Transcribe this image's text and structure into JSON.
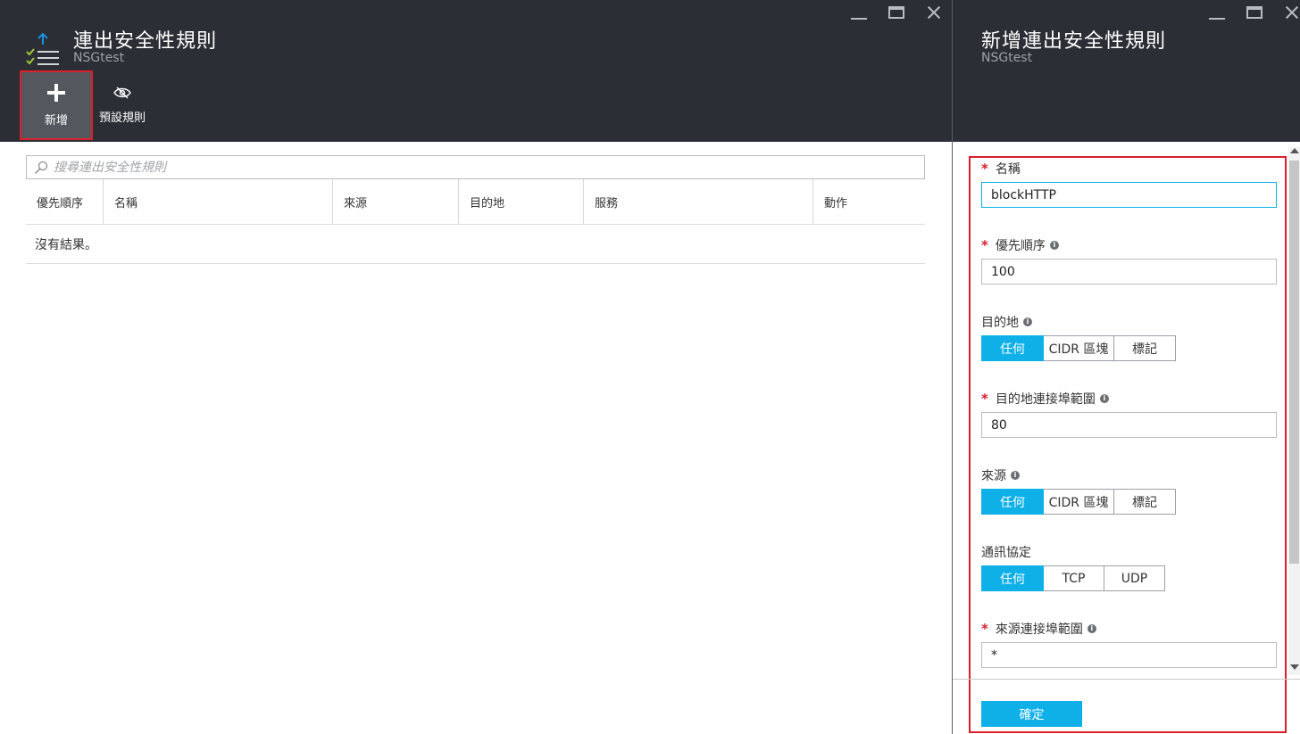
{
  "left_blade": {
    "title": "連出安全性規則",
    "subtitle": "NSGtest",
    "commands": {
      "add_label": "新增",
      "defaults_label": "預設規則"
    },
    "search": {
      "placeholder": "搜尋連出安全性規則"
    },
    "grid": {
      "columns": [
        "優先順序",
        "名稱",
        "來源",
        "目的地",
        "服務",
        "動作"
      ],
      "empty_message": "沒有結果。"
    }
  },
  "right_blade": {
    "title": "新增連出安全性規則",
    "subtitle": "NSGtest",
    "fields": {
      "name": {
        "label": "名稱",
        "value": "blockHTTP"
      },
      "priority": {
        "label": "優先順序",
        "value": "100"
      },
      "destination": {
        "label": "目的地",
        "options": [
          "任何",
          "CIDR 區塊",
          "標記"
        ],
        "selected": "任何"
      },
      "destination_port": {
        "label": "目的地連接埠範圍",
        "value": "80"
      },
      "source": {
        "label": "來源",
        "options": [
          "任何",
          "CIDR 區塊",
          "標記"
        ],
        "selected": "任何"
      },
      "protocol": {
        "label": "通訊協定",
        "options": [
          "任何",
          "TCP",
          "UDP"
        ],
        "selected": "任何"
      },
      "source_port": {
        "label": "來源連接埠範圍",
        "value": "*"
      }
    },
    "ok_label": "確定"
  },
  "colors": {
    "header_bg": "#2b2f35",
    "accent": "#0fb0e8",
    "highlight_border": "#d9202b"
  }
}
